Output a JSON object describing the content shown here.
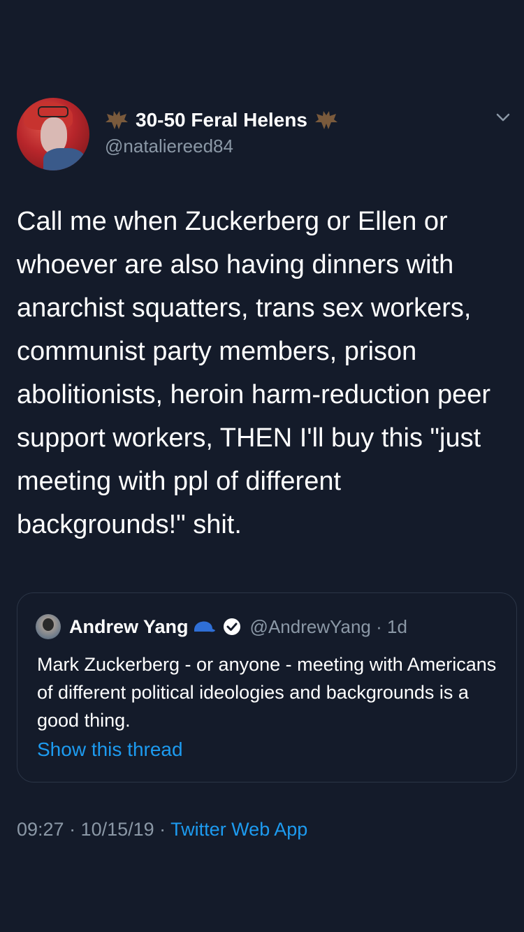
{
  "tweet": {
    "display_name": "30-50 Feral Helens",
    "handle": "@nataliereed84",
    "text": "Call me when Zuckerberg or Ellen or whoever are also having dinners with anarchist squatters, trans sex workers, communist party members, prison abolitionists, heroin harm-reduction peer support workers, THEN I'll buy this \"just meeting with ppl of different backgrounds!\" shit.",
    "name_emoji": "bat-icon",
    "menu_icon": "chevron-down-icon"
  },
  "quote": {
    "display_name": "Andrew Yang",
    "handle_and_time": "@AndrewYang · 1d",
    "text": "Mark Zuckerberg - or anyone - meeting with Americans of different political ideologies and backgrounds is a good thing.",
    "show_thread": "Show this thread",
    "badges": [
      "blue-cap-icon",
      "verified-icon"
    ]
  },
  "meta": {
    "time_date": "09:27 · 10/15/19 · ",
    "source": "Twitter Web App"
  },
  "colors": {
    "background": "#141b2a",
    "muted": "#8b98a6",
    "link": "#1d9bf0",
    "border": "#2b3546"
  }
}
